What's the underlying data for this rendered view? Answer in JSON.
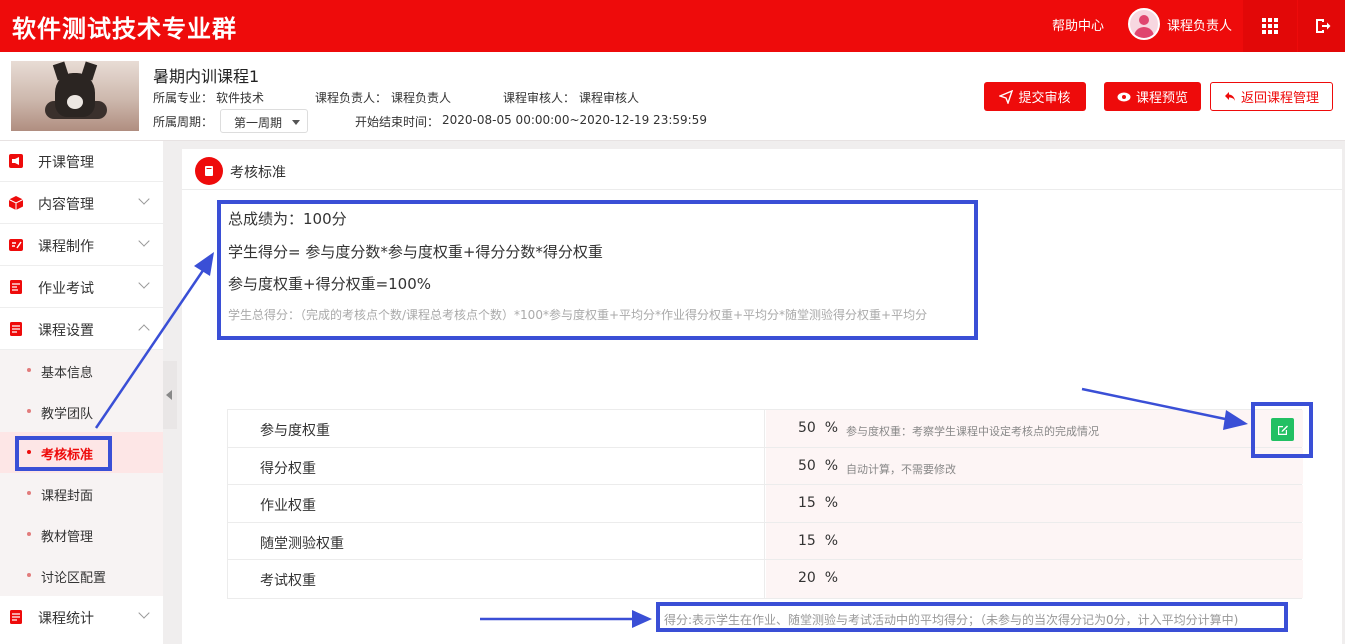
{
  "topbar": {
    "brand": "软件测试技术专业群",
    "help_label": "帮助中心",
    "user_name": "课程负责人"
  },
  "course": {
    "name": "暑期内训课程1",
    "major_label": "所属专业：",
    "major_value": "软件技术",
    "owner_label": "课程负责人：",
    "owner_value": "课程负责人",
    "reviewer_label": "课程审核人：",
    "reviewer_value": "课程审核人",
    "period_label": "所属周期：",
    "period_value": "第一周期",
    "time_label": "开始结束时间：",
    "time_value": "2020-08-05 00:00:00~2020-12-19 23:59:59",
    "buttons": {
      "submit": "提交审核",
      "preview": "课程预览",
      "back": "返回课程管理"
    }
  },
  "sidebar": {
    "items": [
      {
        "label": "开课管理"
      },
      {
        "label": "内容管理"
      },
      {
        "label": "课程制作"
      },
      {
        "label": "作业考试"
      },
      {
        "label": "课程设置"
      },
      {
        "label": "课程统计"
      }
    ],
    "sub_items": [
      {
        "label": "基本信息"
      },
      {
        "label": "教学团队"
      },
      {
        "label": "考核标准"
      },
      {
        "label": "课程封面"
      },
      {
        "label": "教材管理"
      },
      {
        "label": "讨论区配置"
      }
    ]
  },
  "panel": {
    "title": "考核标准",
    "formula_total": "总成绩为：100分",
    "formula_score": "学生得分= 参与度分数*参与度权重+得分分数*得分权重",
    "formula_weights": "参与度权重+得分权重=100%",
    "formula_detail": "学生总得分：（完成的考核点个数/课程总考核点个数）*100*参与度权重+平均分*作业得分权重+平均分*随堂测验得分权重+平均分",
    "rows": [
      {
        "name": "参与度权重",
        "value": "50",
        "unit": "%",
        "desc": "参与度权重：考察学生课程中设定考核点的完成情况"
      },
      {
        "name": "得分权重",
        "value": "50",
        "unit": "%",
        "desc": "自动计算，不需要修改"
      },
      {
        "name": "作业权重",
        "value": "15",
        "unit": "%",
        "desc": ""
      },
      {
        "name": "随堂测验权重",
        "value": "15",
        "unit": "%",
        "desc": ""
      },
      {
        "name": "考试权重",
        "value": "20",
        "unit": "%",
        "desc": ""
      }
    ],
    "note": "得分:表示学生在作业、随堂测验与考试活动中的平均得分；（未参与的当次得分记为0分，计入平均分计算中)"
  },
  "colors": {
    "brand_red": "#ee0b0b",
    "annotation_blue": "#3a4fd6",
    "edit_green": "#22c063"
  }
}
